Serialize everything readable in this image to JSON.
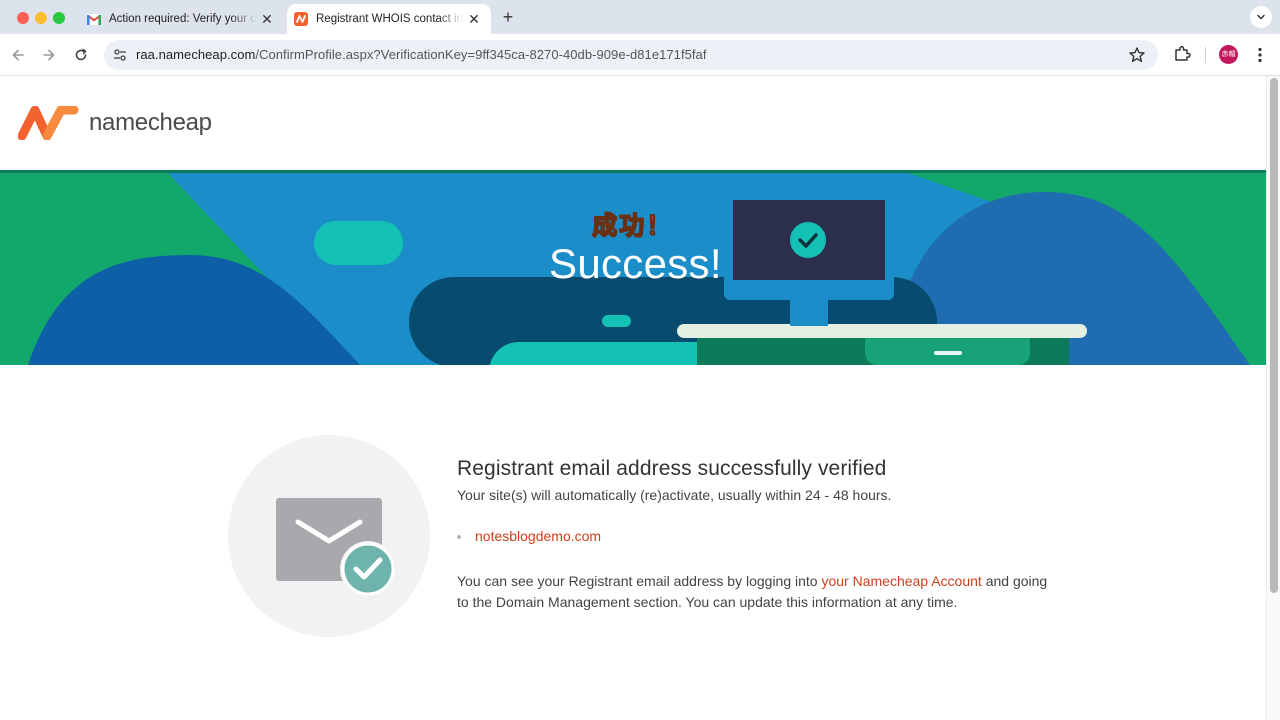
{
  "browser": {
    "tabs": [
      {
        "title": "Action required: Verify your contact information",
        "favicon": "gmail-icon",
        "active": false
      },
      {
        "title": "Registrant WHOIS contact information",
        "favicon": "namecheap-icon",
        "active": true
      }
    ],
    "url_host": "raa.namecheap.com",
    "url_path": "/ConfirmProfile.aspx?VerificationKey=9ff345ca-8270-40db-909e-d81e171f5faf",
    "profile_label": "赤帽"
  },
  "site": {
    "logo_text": "namecheap"
  },
  "hero": {
    "annotation": "成功！",
    "title": "Success!"
  },
  "main": {
    "heading": "Registrant email address successfully verified",
    "subtext": "Your site(s) will automatically (re)activate, usually within 24 - 48 hours.",
    "domains": [
      "notesblogdemo.com"
    ],
    "paragraph_before_link": "You can see your Registrant email address by logging into ",
    "account_link": "your Namecheap Account",
    "paragraph_after_link": " and going to the Domain Management section. You can update this information at any time."
  },
  "colors": {
    "brand_orange": "#f2622e",
    "link_red": "#d0401b",
    "hero_blue": "#1b8ec9",
    "hero_green": "#13a86b",
    "hero_dark": "#074c6e",
    "hero_teal": "#13c2b5"
  }
}
